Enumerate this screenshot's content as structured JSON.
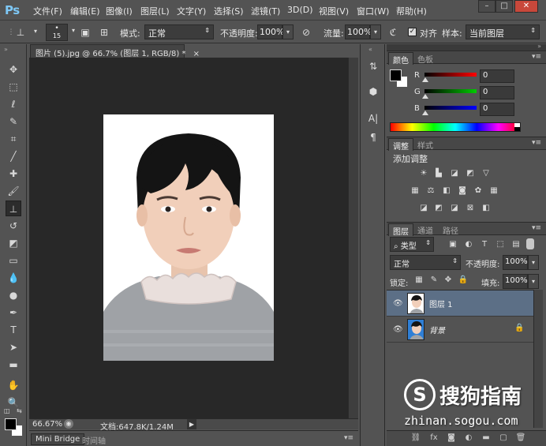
{
  "app": {
    "logo": "Ps"
  },
  "menu": [
    "文件(F)",
    "编辑(E)",
    "图像(I)",
    "图层(L)",
    "文字(Y)",
    "选择(S)",
    "滤镜(T)",
    "3D(D)",
    "视图(V)",
    "窗口(W)",
    "帮助(H)"
  ],
  "window_controls": {
    "minimize": "–",
    "restore": "□",
    "close": "✕"
  },
  "options": {
    "brush_size": "15",
    "mode_label": "模式:",
    "mode_value": "正常",
    "opacity_label": "不透明度:",
    "opacity_value": "100%",
    "flow_label": "流量:",
    "flow_value": "100%",
    "align_label": "对齐",
    "sample_label": "样本:",
    "sample_value": "当前图层"
  },
  "document": {
    "tab_title": "图片 (5).jpg @ 66.7% (图层 1, RGB/8) *",
    "tab_close": "×",
    "zoom": "66.67%",
    "doc_info": "文档:647.8K/1.24M"
  },
  "bottom_tabs": [
    "Mini Bridge",
    "时间轴"
  ],
  "color_panel": {
    "tabs": [
      "颜色",
      "色板"
    ],
    "channels": [
      {
        "label": "R",
        "value": "0",
        "color": "#ff0000"
      },
      {
        "label": "G",
        "value": "0",
        "color": "#00cc00"
      },
      {
        "label": "B",
        "value": "0",
        "color": "#0000ff"
      }
    ]
  },
  "adjust_panel": {
    "tabs": [
      "调整",
      "样式"
    ],
    "title": "添加调整"
  },
  "layers_panel": {
    "tabs": [
      "图层",
      "通道",
      "路径"
    ],
    "filter_label": "类型",
    "blend_mode": "正常",
    "opacity_label": "不透明度:",
    "opacity_value": "100%",
    "lock_label": "锁定:",
    "fill_label": "填充:",
    "fill_value": "100%",
    "layers": [
      {
        "name": "图层 1",
        "selected": true
      },
      {
        "name": "背景",
        "selected": false
      }
    ]
  },
  "watermark": {
    "logo": "S",
    "text": "搜狗指南",
    "url": "zhinan.sogou.com"
  }
}
